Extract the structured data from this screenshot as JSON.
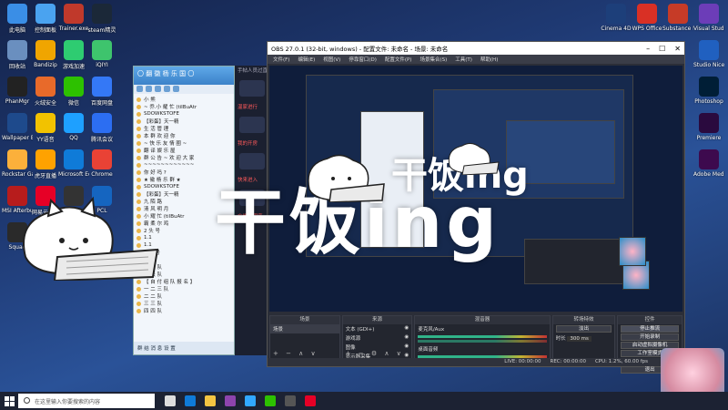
{
  "desktop": {
    "left_icons": [
      {
        "label": "此电脑",
        "color": "#3a8ee6"
      },
      {
        "label": "控制面板",
        "color": "#4aa3f0"
      },
      {
        "label": "Trainer.exe",
        "color": "#c0392b"
      },
      {
        "label": "steam精灵",
        "color": "#1b2838"
      },
      {
        "label": "回收站",
        "color": "#6a8fbf"
      },
      {
        "label": "Bandizip",
        "color": "#f0a500"
      },
      {
        "label": "游戏加速",
        "color": "#2ecc71"
      },
      {
        "label": "iQIYI",
        "color": "#3ec46d"
      },
      {
        "label": "PhanMgr",
        "color": "#222"
      },
      {
        "label": "火绒安全",
        "color": "#e86a2a"
      },
      {
        "label": "微信",
        "color": "#2dc100"
      },
      {
        "label": "百度网盘",
        "color": "#3478f6"
      },
      {
        "label": "Wallpaper Engine",
        "color": "#1e4a8c"
      },
      {
        "label": "YY语音",
        "color": "#f2c200"
      },
      {
        "label": "QQ",
        "color": "#1ea0ff"
      },
      {
        "label": "腾讯会议",
        "color": "#2c6ef2"
      },
      {
        "label": "Rockstar Games",
        "color": "#fbb03b"
      },
      {
        "label": "虎牙直播",
        "color": "#ffa200"
      },
      {
        "label": "Microsoft Edge",
        "color": "#0f7bd8"
      },
      {
        "label": "Chrome",
        "color": "#e94235"
      },
      {
        "label": "MSI Afterburner",
        "color": "#b71c1c"
      },
      {
        "label": "网易云音乐",
        "color": "#e60026"
      },
      {
        "label": "Geek",
        "color": "#333"
      },
      {
        "label": "PCL",
        "color": "#1565c0"
      },
      {
        "label": "Squad",
        "color": "#2a2a2a"
      },
      {
        "label": "QQ音乐",
        "color": "#31c27c"
      }
    ],
    "right_icons": [
      {
        "label": "Cinema 4D",
        "color": "#1d3f7a"
      },
      {
        "label": "WPS Office",
        "color": "#d93025"
      },
      {
        "label": "Substance Painter",
        "color": "#c63b27"
      },
      {
        "label": "Visual Studio 2019",
        "color": "#6c3db8"
      },
      {
        "label": "Studio Nice",
        "color": "#2060c0"
      },
      {
        "label": "Photoshop",
        "color": "#001e36"
      },
      {
        "label": "Premiere",
        "color": "#2a0a3e"
      },
      {
        "label": "Adobe Media",
        "color": "#3d0a4e"
      }
    ]
  },
  "qq_chat": {
    "title": "〇 翻 徽 杨 乐 国 〇",
    "items": [
      "小 熊",
      "~ 乔.小 耀 忙 (tiIBuAtr",
      "SDOWKSTOFE",
      "【彩蛋】天一精",
      "生 活 管 理",
      "本 群 欢 迎 你",
      "~ 快 乐 友 情 圈 ~",
      "翻 译 娱 乐 屋",
      "群 公 告 ~ 欢 迎 大 家",
      "~~~~~~~~~~~~",
      "你 好 吗 ?",
      "★ 徽 杨 乐 群 ★",
      "SDOWKSTOFE",
      "【彩蛋】天一精",
      "九 陌 路",
      "清 风 明 月",
      "小 耀 忙 (tiIBuAtr",
      "霸 柔 尔 鸡",
      "2 头 号",
      "1.1",
      "1.1",
      "2 头 号",
      "4队",
      "我 张 队",
      "我 张 队",
      "【 自 付 组 队 报 名 】",
      "一 二 三 队",
      "二 二 队",
      "三 三 队",
      "四 四 队"
    ],
    "footer": "群 结 消 息 设 置",
    "side_notice": "手帖人员过直接",
    "side_red": [
      "温家进行",
      "我的开房",
      "快来进入",
      "广告小程序"
    ]
  },
  "obs": {
    "title": "OBS 27.0.1 (32-bit, windows) - 配置文件: 未命名 - 场景: 未命名",
    "menu": [
      "文件(F)",
      "编辑(E)",
      "视图(V)",
      "停靠窗口(D)",
      "配置文件(P)",
      "场景集合(S)",
      "工具(T)",
      "帮助(H)"
    ],
    "docks": {
      "scenes": {
        "header": "场景",
        "items": [
          "场景"
        ]
      },
      "sources": {
        "header": "来源",
        "items": [
          "文本 (GDI+)",
          "游戏源",
          "图像",
          "显示器采集"
        ]
      },
      "mixer": {
        "header": "混音器",
        "channels": [
          {
            "name": "麦克风/Aux",
            "db": "0.0 dB"
          },
          {
            "name": "桌面音频",
            "db": "0.0 dB"
          }
        ]
      },
      "transitions": {
        "header": "转场特效",
        "type": "淡出",
        "duration_label": "时长",
        "duration": "300 ms"
      },
      "controls": {
        "header": "控件",
        "buttons": [
          "停止推流",
          "开始录制",
          "启动虚拟摄像机",
          "工作室模式",
          "设置",
          "退出"
        ]
      }
    },
    "status": {
      "live": "LIVE: 00:00:00",
      "rec": "REC: 00:00:00",
      "cpu": "CPU: 1.2%, 60.00 fps"
    },
    "overlay_title": "干 饭 ing"
  },
  "overlay": {
    "big_text": "干饭ing",
    "mid_text": "干饭ing"
  },
  "taskbar": {
    "search_placeholder": "在这里输入你要搜索的内容",
    "icons": [
      {
        "name": "task-view-icon",
        "color": "#ddd"
      },
      {
        "name": "edge-icon",
        "color": "#0f7bd8"
      },
      {
        "name": "file-explorer-icon",
        "color": "#f4c542"
      },
      {
        "name": "vs-icon",
        "color": "#8e44ad"
      },
      {
        "name": "ps-icon",
        "color": "#31a8ff"
      },
      {
        "name": "wechat-icon",
        "color": "#2dc100"
      },
      {
        "name": "obs-icon",
        "color": "#555"
      },
      {
        "name": "netease-icon",
        "color": "#e60026"
      }
    ]
  }
}
